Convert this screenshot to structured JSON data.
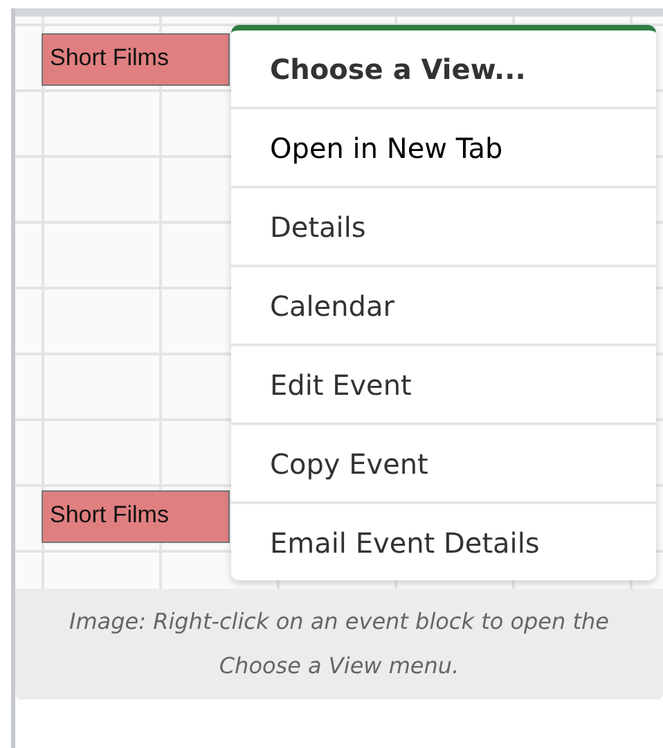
{
  "calendar": {
    "events": [
      {
        "title": "Short Films"
      },
      {
        "title": "Short Films"
      }
    ]
  },
  "context_menu": {
    "items": [
      {
        "kind": "header",
        "label": "Choose a View...",
        "highlighted": false
      },
      {
        "kind": "item",
        "label": "Open in New Tab",
        "highlighted": true
      },
      {
        "kind": "item",
        "label": "Details",
        "highlighted": false
      },
      {
        "kind": "item",
        "label": "Calendar",
        "highlighted": false
      },
      {
        "kind": "item",
        "label": "Edit Event",
        "highlighted": false
      },
      {
        "kind": "item",
        "label": "Copy Event",
        "highlighted": false
      },
      {
        "kind": "item",
        "label": "Email Event Details",
        "highlighted": false
      }
    ]
  },
  "caption": "Image: Right-click on an event block to open the Choose a View menu."
}
